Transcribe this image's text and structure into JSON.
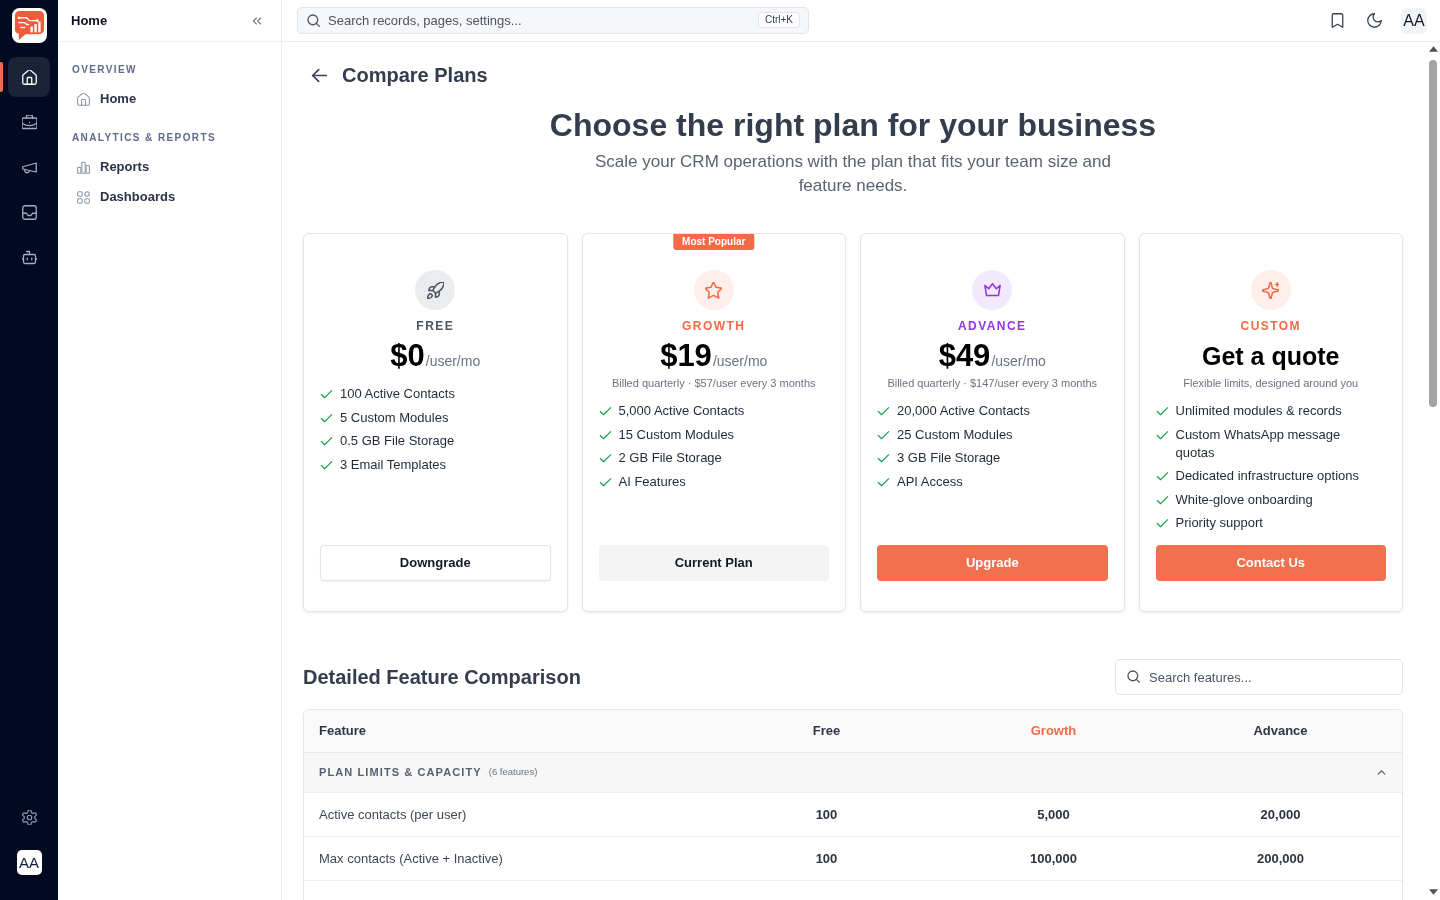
{
  "rail": {
    "items": [
      {
        "selected": true
      },
      {
        "selected": false
      },
      {
        "selected": false
      },
      {
        "selected": false
      },
      {
        "selected": false
      }
    ],
    "avatar": "AA"
  },
  "sidebar": {
    "title": "Home",
    "sections": [
      {
        "heading": "OVERVIEW",
        "items": [
          {
            "label": "Home",
            "selected": false
          }
        ]
      },
      {
        "heading": "ANALYTICS & REPORTS",
        "items": [
          {
            "label": "Reports",
            "selected": false
          },
          {
            "label": "Dashboards",
            "selected": false
          }
        ]
      }
    ]
  },
  "topbar": {
    "search": {
      "placeholder": "Search records, pages, settings...",
      "shortcut": "Ctrl+K"
    },
    "avatar": "AA"
  },
  "page": {
    "title": "Compare Plans",
    "headline": "Choose the right plan for your business",
    "subtitle": "Scale your CRM operations with the plan that fits your team size and feature needs."
  },
  "plans": [
    {
      "name": "FREE",
      "color": "#4b5563",
      "price": "$0",
      "period": "/user/mo",
      "features": [
        "100 Active Contacts",
        "5 Custom Modules",
        "0.5 GB File Storage",
        "3 Email Templates"
      ],
      "button": {
        "label": "Downgrade",
        "kind": "outline"
      }
    },
    {
      "name": "GROWTH",
      "color": "#f26b46",
      "badge": "Most Popular",
      "price": "$19",
      "period": "/user/mo",
      "note": "Billed quarterly · $57/user every 3 months",
      "features": [
        "5,000 Active Contacts",
        "15 Custom Modules",
        "2 GB File Storage",
        "AI Features"
      ],
      "button": {
        "label": "Current Plan",
        "kind": "muted"
      }
    },
    {
      "name": "ADVANCE",
      "color": "#9333ea",
      "price": "$49",
      "period": "/user/mo",
      "note": "Billed quarterly · $147/user every 3 months",
      "features": [
        "20,000 Active Contacts",
        "25 Custom Modules",
        "3 GB File Storage",
        "API Access"
      ],
      "button": {
        "label": "Upgrade",
        "kind": "primary"
      }
    },
    {
      "name": "CUSTOM",
      "color": "#f26b46",
      "price": "Get a quote",
      "note": "Flexible limits, designed around you",
      "features": [
        "Unlimited modules & records",
        "Custom WhatsApp message quotas",
        "Dedicated infrastructure options",
        "White-glove onboarding",
        "Priority support"
      ],
      "button": {
        "label": "Contact Us",
        "kind": "primary"
      }
    }
  ],
  "comparison": {
    "title": "Detailed Feature Comparison",
    "search": {
      "placeholder": "Search features..."
    },
    "columns": [
      {
        "label": "Feature",
        "highlighted": false
      },
      {
        "label": "Free",
        "highlighted": false
      },
      {
        "label": "Growth",
        "highlighted": true
      },
      {
        "label": "Advance",
        "highlighted": false
      }
    ],
    "groups": [
      {
        "title": "PLAN LIMITS & CAPACITY",
        "count": "(6 features)",
        "expanded": true,
        "rows": [
          [
            "Active contacts (per user)",
            "100",
            "5,000",
            "20,000"
          ],
          [
            "Max contacts (Active + Inactive)",
            "100",
            "100,000",
            "200,000"
          ]
        ]
      }
    ]
  }
}
